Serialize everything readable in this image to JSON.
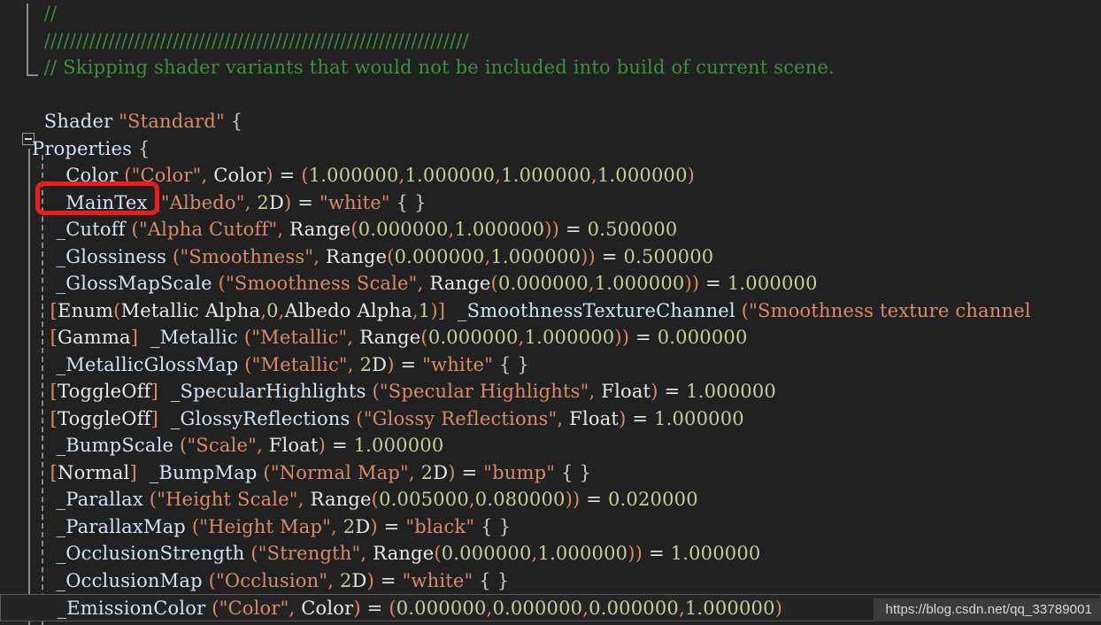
{
  "editor": {
    "background_color": "#212121",
    "comment_color": "#3f8f3f",
    "string_color": "#d98b6a",
    "number_color": "#c3cf9a",
    "property_color": "#cfe3f7",
    "keyword_color": "#e8e8e8",
    "type_color": "#8fc79a",
    "annotation_box_color": "#f21b1b",
    "fold_guide_color": "#8c8c8c",
    "current_line_border_color": "#595959"
  },
  "watermark": {
    "text": "https://blog.csdn.net/qq_33789001"
  },
  "annotation": {
    "target_token": "_MainTex",
    "shape": "rounded-rectangle",
    "color": "#f21b1b"
  },
  "fold_markers": {
    "properties_collapse_label": "-",
    "properties_collapse_state": "expanded"
  },
  "lines": [
    {
      "id": "line-1",
      "kind": "comment",
      "text": "  //"
    },
    {
      "id": "line-2",
      "kind": "comment",
      "text": "  //////////////////////////////////////////////////////////////////"
    },
    {
      "id": "line-3",
      "kind": "comment",
      "text": "  // Skipping shader variants that would not be included into build of current scene."
    },
    {
      "id": "line-4",
      "kind": "blank",
      "text": " "
    },
    {
      "id": "line-5",
      "kind": "code",
      "text": "  Shader \"Standard\" {"
    },
    {
      "id": "line-6",
      "kind": "code",
      "text": "Properties {"
    },
    {
      "id": "line-7",
      "kind": "code",
      "text": "    _Color (\"Color\", Color) = (1.000000,1.000000,1.000000,1.000000)"
    },
    {
      "id": "line-8",
      "kind": "code",
      "text": "    _MainTex (\"Albedo\", 2D) = \"white\" { }"
    },
    {
      "id": "line-9",
      "kind": "code",
      "text": "    _Cutoff (\"Alpha Cutoff\", Range(0.000000,1.000000)) = 0.500000"
    },
    {
      "id": "line-10",
      "kind": "code",
      "text": "    _Glossiness (\"Smoothness\", Range(0.000000,1.000000)) = 0.500000"
    },
    {
      "id": "line-11",
      "kind": "code",
      "text": "    _GlossMapScale (\"Smoothness Scale\", Range(0.000000,1.000000)) = 1.000000"
    },
    {
      "id": "line-12",
      "kind": "code",
      "text": "   [Enum(Metallic Alpha,0,Albedo Alpha,1)]  _SmoothnessTextureChannel (\"Smoothness texture channel"
    },
    {
      "id": "line-13",
      "kind": "code",
      "text": "   [Gamma]  _Metallic (\"Metallic\", Range(0.000000,1.000000)) = 0.000000"
    },
    {
      "id": "line-14",
      "kind": "code",
      "text": "    _MetallicGlossMap (\"Metallic\", 2D) = \"white\" { }"
    },
    {
      "id": "line-15",
      "kind": "code",
      "text": "   [ToggleOff]  _SpecularHighlights (\"Specular Highlights\", Float) = 1.000000"
    },
    {
      "id": "line-16",
      "kind": "code",
      "text": "   [ToggleOff]  _GlossyReflections (\"Glossy Reflections\", Float) = 1.000000"
    },
    {
      "id": "line-17",
      "kind": "code",
      "text": "    _BumpScale (\"Scale\", Float) = 1.000000"
    },
    {
      "id": "line-18",
      "kind": "code",
      "text": "   [Normal]  _BumpMap (\"Normal Map\", 2D) = \"bump\" { }"
    },
    {
      "id": "line-19",
      "kind": "code",
      "text": "    _Parallax (\"Height Scale\", Range(0.005000,0.080000)) = 0.020000"
    },
    {
      "id": "line-20",
      "kind": "code",
      "text": "    _ParallaxMap (\"Height Map\", 2D) = \"black\" { }"
    },
    {
      "id": "line-21",
      "kind": "code",
      "text": "    _OcclusionStrength (\"Strength\", Range(0.000000,1.000000)) = 1.000000"
    },
    {
      "id": "line-22",
      "kind": "code",
      "text": "    _OcclusionMap (\"Occlusion\", 2D) = \"white\" { }"
    },
    {
      "id": "line-23",
      "kind": "code",
      "current": true,
      "text": "    _EmissionColor (\"Color\", Color) = (0.000000,0.000000,0.000000,1.000000)"
    }
  ]
}
